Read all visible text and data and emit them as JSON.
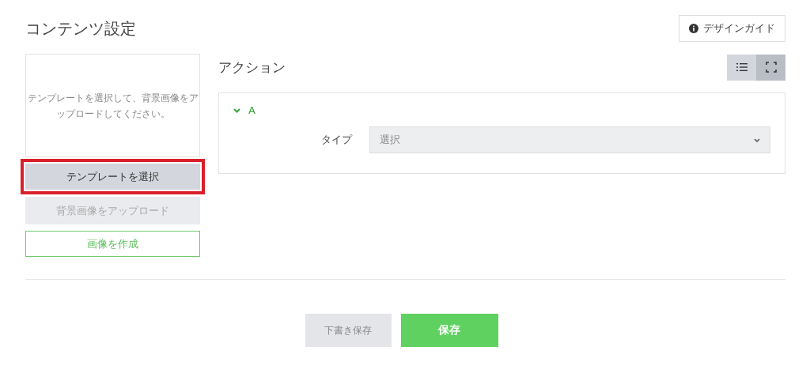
{
  "page": {
    "title": "コンテンツ設定",
    "guide_button": "デザインガイド"
  },
  "preview": {
    "hint": "テンプレートを選択して、背景画像をアップロードしてください。"
  },
  "side_buttons": [
    {
      "kind": "template",
      "label": "テンプレートを選択",
      "highlighted": true,
      "disabled": false
    },
    {
      "kind": "upload",
      "label": "背景画像をアップロード",
      "highlighted": false,
      "disabled": true
    },
    {
      "kind": "create",
      "label": "画像を作成",
      "highlighted": false,
      "disabled": false
    }
  ],
  "actions": {
    "title": "アクション",
    "view_toggle": [
      {
        "kind": "list",
        "selected": false
      },
      {
        "kind": "expand",
        "selected": true
      }
    ],
    "items": [
      {
        "label": "A",
        "expanded": true,
        "field_label": "タイプ",
        "select_value": "選択"
      }
    ]
  },
  "footer": {
    "draft_button": "下書き保存",
    "save_button": "保存"
  }
}
